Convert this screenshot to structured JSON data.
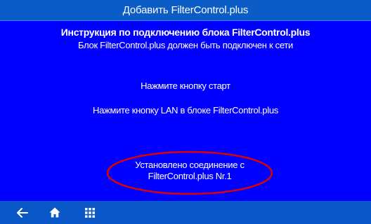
{
  "window": {
    "title": "Добавить FilterControl.plus"
  },
  "content": {
    "heading": "Инструкция по подключению блока FilterControl.plus",
    "subheading": "Блок FilterControl.plus должен быть подключен к сети",
    "steps": [
      "Нажмите кнопку старт",
      "Нажмите кнопку LAN в блоке FilterControl.plus"
    ],
    "status": {
      "line1": "Установлено соединение с",
      "line2": "FilterControl.plus Nr.1",
      "highlight_color": "#e00000"
    }
  },
  "nav": {
    "icons": [
      "back-arrow-icon",
      "home-icon",
      "grid-menu-icon"
    ]
  },
  "colors": {
    "background": "#0000ff",
    "title_bar": "#0c5cc8",
    "nav_bar": "#0a58c8",
    "text": "#ffffff"
  }
}
